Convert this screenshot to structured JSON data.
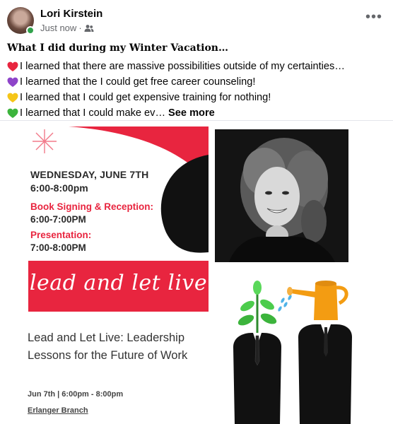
{
  "post": {
    "author": "Lori Kirstein",
    "timestamp": "Just now",
    "audience_icon": "friends-icon",
    "more_icon": "more-options-icon",
    "title": "What I did during my Winter Vacation…",
    "lines": [
      {
        "icon": "red-heart",
        "color": "#e8253f",
        "text": "I learned that there are massive possibilities outside of my certainties…"
      },
      {
        "icon": "purple-heart",
        "color": "#8e44c9",
        "text": "I learned that the I could get free career counseling!"
      },
      {
        "icon": "yellow-heart",
        "color": "#f5c518",
        "text": "I learned that I could get expensive training for nothing!"
      },
      {
        "icon": "green-heart",
        "color": "#3cb43c",
        "text": "I learned that I could make ev…"
      }
    ],
    "see_more": "See more"
  },
  "flyer": {
    "date": "WEDNESDAY, JUNE 7TH",
    "time": "6:00-8:00pm",
    "signing_label": "Book Signing & Reception:",
    "signing_time": "6:00-7:00PM",
    "presentation_label": "Presentation:",
    "presentation_time": "7:00-8:00PM",
    "banner": "lead and let live",
    "book_title": "Lead and Let Live: Leadership Lessons for the Future of Work",
    "book_time": "Jun 7th | 6:00pm - 8:00pm",
    "branch": "Erlanger Branch"
  },
  "colors": {
    "accent_red": "#e8253f",
    "online": "#31a24c",
    "meta_gray": "#65676b",
    "watering_can": "#f39c12"
  }
}
